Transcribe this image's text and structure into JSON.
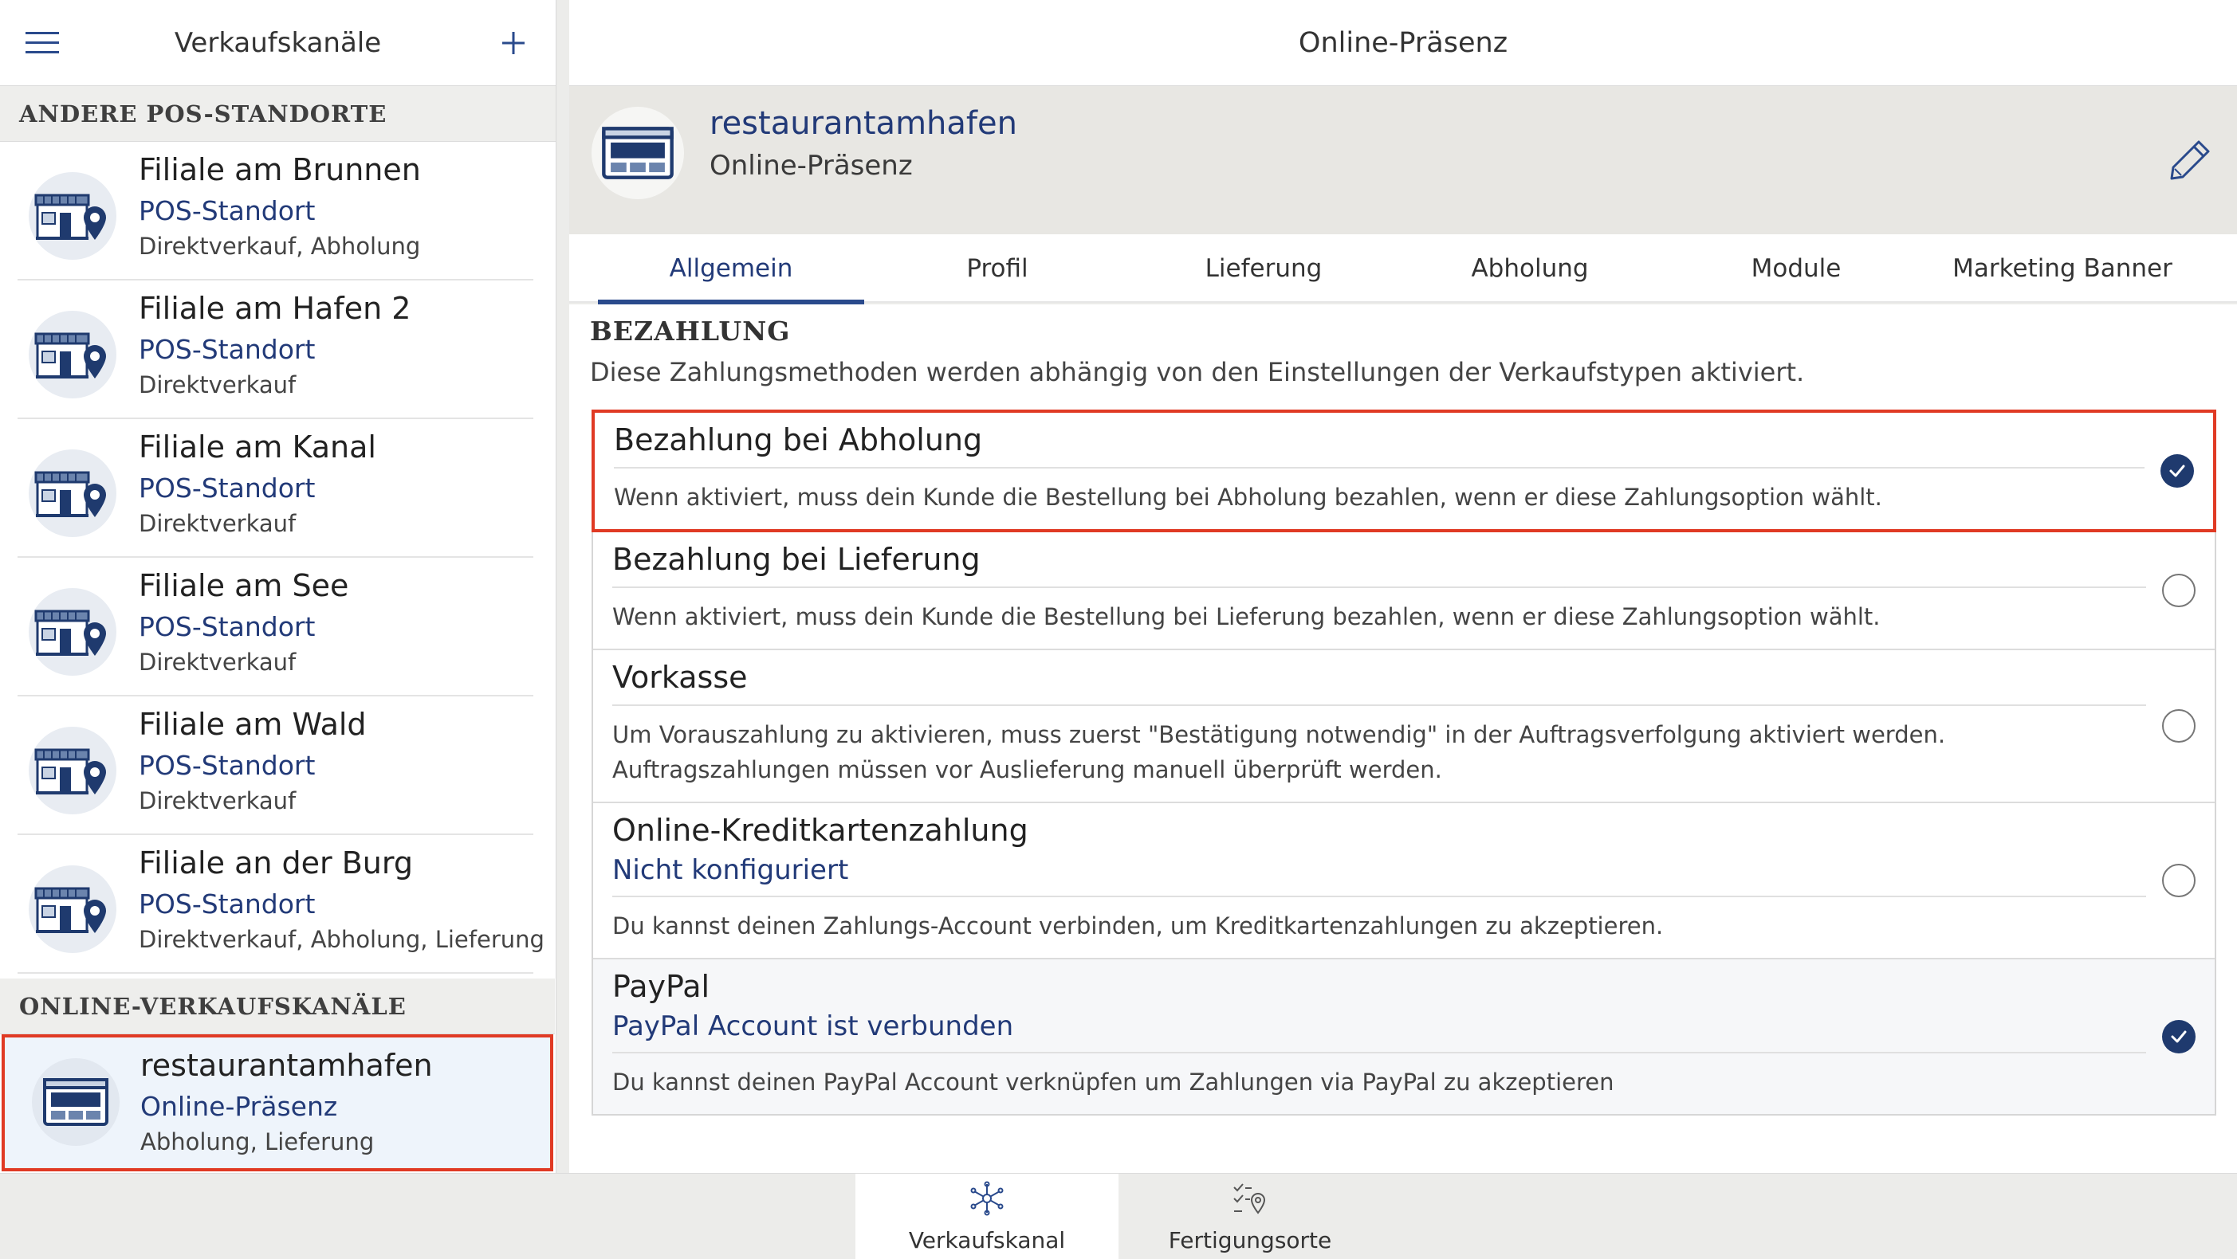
{
  "left": {
    "title": "Verkaufskanäle",
    "section_pos": "ANDERE POS-STANDORTE",
    "section_online": "ONLINE-VERKAUFSKANÄLE",
    "locations": [
      {
        "name": "Filiale am Brunnen",
        "type": "POS-Standort",
        "sub": "Direktverkauf, Abholung"
      },
      {
        "name": "Filiale am Hafen 2",
        "type": "POS-Standort",
        "sub": "Direktverkauf"
      },
      {
        "name": "Filiale am Kanal",
        "type": "POS-Standort",
        "sub": "Direktverkauf"
      },
      {
        "name": "Filiale am See",
        "type": "POS-Standort",
        "sub": "Direktverkauf"
      },
      {
        "name": "Filiale am Wald",
        "type": "POS-Standort",
        "sub": "Direktverkauf"
      },
      {
        "name": "Filiale an der Burg",
        "type": "POS-Standort",
        "sub": "Direktverkauf, Abholung, Lieferung"
      }
    ],
    "online": {
      "name": "restaurantamhafen",
      "type": "Online-Präsenz",
      "sub": "Abholung, Lieferung"
    }
  },
  "right": {
    "title": "Online-Präsenz",
    "profile": {
      "name": "restaurantamhafen",
      "type": "Online-Präsenz"
    },
    "tabs": [
      {
        "label": "Allgemein",
        "active": true
      },
      {
        "label": "Profil",
        "active": false
      },
      {
        "label": "Lieferung",
        "active": false
      },
      {
        "label": "Abholung",
        "active": false
      },
      {
        "label": "Module",
        "active": false
      },
      {
        "label": "Marketing Banner",
        "active": false
      }
    ],
    "payment": {
      "title": "BEZAHLUNG",
      "desc": "Diese Zahlungsmethoden werden abhängig von den Einstellungen der Verkaufstypen aktiviert.",
      "methods": [
        {
          "title": "Bezahlung bei Abholung",
          "status": "",
          "desc": "Wenn aktiviert, muss dein Kunde die Bestellung bei Abholung bezahlen, wenn er diese Zahlungsoption wählt.",
          "checked": true
        },
        {
          "title": "Bezahlung bei Lieferung",
          "status": "",
          "desc": "Wenn aktiviert, muss dein Kunde die Bestellung bei Lieferung bezahlen, wenn er diese Zahlungsoption wählt.",
          "checked": false
        },
        {
          "title": "Vorkasse",
          "status": "",
          "desc": "Um Vorauszahlung zu aktivieren, muss zuerst \"Bestätigung notwendig\" in der Auftragsverfolgung aktiviert werden. Auftragszahlungen müssen vor Auslieferung manuell überprüft werden.",
          "checked": false
        },
        {
          "title": "Online-Kreditkartenzahlung",
          "status": "Nicht konfiguriert",
          "desc": "Du kannst deinen Zahlungs-Account verbinden, um Kreditkartenzahlungen zu akzeptieren.",
          "checked": false
        },
        {
          "title": "PayPal",
          "status": "PayPal Account ist verbunden",
          "desc": "Du kannst deinen PayPal Account verknüpfen um Zahlungen via PayPal zu akzeptieren",
          "checked": true
        }
      ]
    }
  },
  "bottom": {
    "tabs": [
      {
        "label": "Verkaufskanal",
        "icon": "snowflake-network-icon",
        "active": true
      },
      {
        "label": "Fertigungsorte",
        "icon": "checklist-pin-icon",
        "active": false
      }
    ]
  },
  "colors": {
    "accent": "#223a78",
    "highlight": "#e03a24"
  }
}
